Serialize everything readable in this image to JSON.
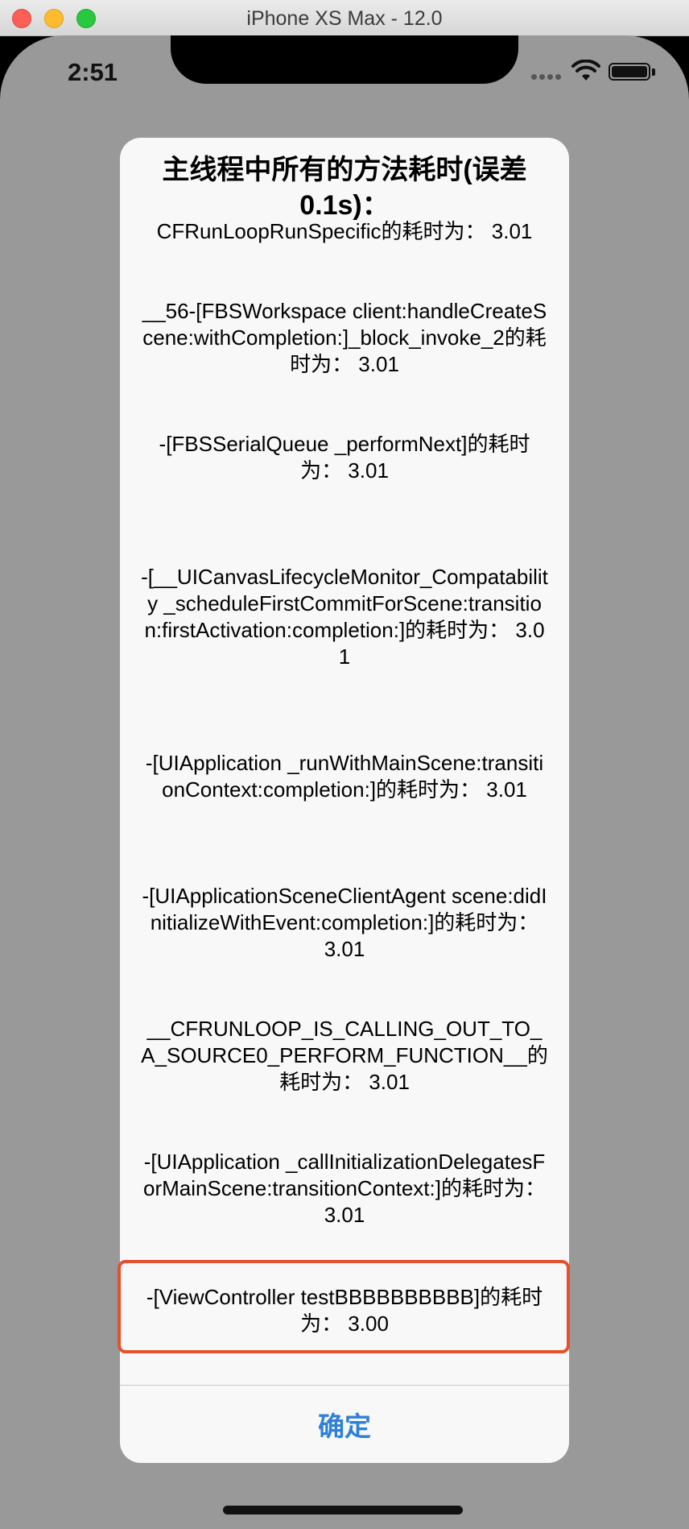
{
  "window": {
    "title": "iPhone XS Max - 12.0"
  },
  "status_bar": {
    "time": "2:51"
  },
  "alert": {
    "title": "主线程中所有的方法耗时(误差0.1s)：",
    "entries": [
      "CFRunLoopRunSpecific的耗时为： 3.01",
      "__56-[FBSWorkspace client:handleCreateScene:withCompletion:]_block_invoke_2的耗时为： 3.01",
      "-[FBSSerialQueue _performNext]的耗时为： 3.01",
      "-[__UICanvasLifecycleMonitor_Compatability _scheduleFirstCommitForScene:transition:firstActivation:completion:]的耗时为： 3.01",
      "-[UIApplication _runWithMainScene:transitionContext:completion:]的耗时为： 3.01",
      "-[UIApplicationSceneClientAgent scene:didInitializeWithEvent:completion:]的耗时为： 3.01",
      "__CFRUNLOOP_IS_CALLING_OUT_TO_A_SOURCE0_PERFORM_FUNCTION__的耗时为： 3.01",
      "-[UIApplication _callInitializationDelegatesForMainScene:transitionContext:]的耗时为： 3.01"
    ],
    "highlighted_entry": "-[ViewController testBBBBBBBBBB]的耗时为： 3.00",
    "confirm_label": "确定"
  },
  "colors": {
    "highlight_border": "#e5512e",
    "button_text": "#2f80d8",
    "screen_dim": "#999999"
  }
}
